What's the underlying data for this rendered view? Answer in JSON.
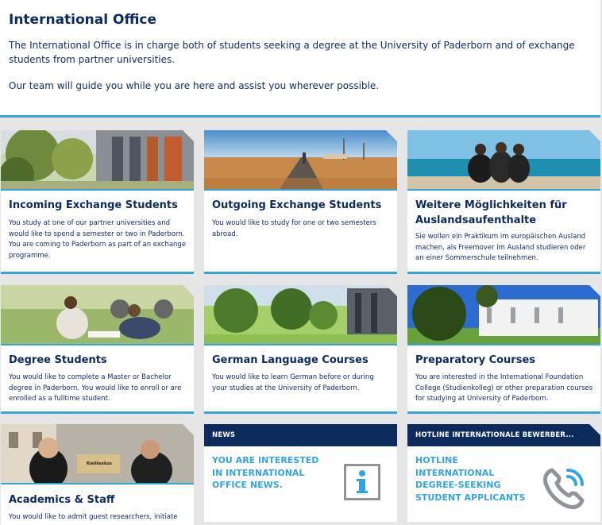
{
  "intro": {
    "title": "International Office",
    "paragraph1": "The International Office is in charge both of students seeking a degree at the University of Paderborn and of exchange students from partner universities.",
    "paragraph2": "Our team will guide you while you are here and assist you wherever possible."
  },
  "cards": [
    {
      "title": "Incoming Exchange Students",
      "text": "You study at one of our partner universities and would like to spend a semester or two in Paderborn. You are coming to Paderborn as part of an exchange programme."
    },
    {
      "title": "Outgoing Exchange Students",
      "text": "You would like to study for one or two semesters abroad."
    },
    {
      "title": "Weitere Möglichkeiten für Auslandsaufenthalte",
      "text": "Sie wollen ein Praktikum im europäischen Ausland machen, als Freemover im Ausland studieren oder an einer Sommerschule teilnehmen."
    },
    {
      "title": "Degree Students",
      "text": "You would like to complete a Master or Bachelor degree in Paderborn. You would like to enroll or are enrolled as a fulltime student."
    },
    {
      "title": "German Language Courses",
      "text": "You would like to learn German before or during your studies at the University of Paderborn."
    },
    {
      "title": "Preparatory Courses",
      "text": "You are interested in the International Foundation College (Studienkolleg) or other preparation courses for studying at University of Paderborn."
    },
    {
      "title": "Academics & Staff",
      "text": "You would like to admit guest researchers, initiate"
    }
  ],
  "news": {
    "header": "NEWS",
    "text": "YOU ARE INTERESTED IN INTERNATIONAL OFFICE NEWS."
  },
  "hotline": {
    "header": "HOTLINE INTERNATIONALE BEWERBER...",
    "text": "HOTLINE INTERNATIONAL DEGREE-SEEKING STUDENT APPLICANTS"
  },
  "plaque_text": "Kielikeskus",
  "colors": {
    "navy": "#0d2a5c",
    "accent_blue": "#35a4dc",
    "background": "#e6e6e6"
  },
  "icons": {
    "news": "info-icon",
    "hotline": "phone-icon"
  }
}
